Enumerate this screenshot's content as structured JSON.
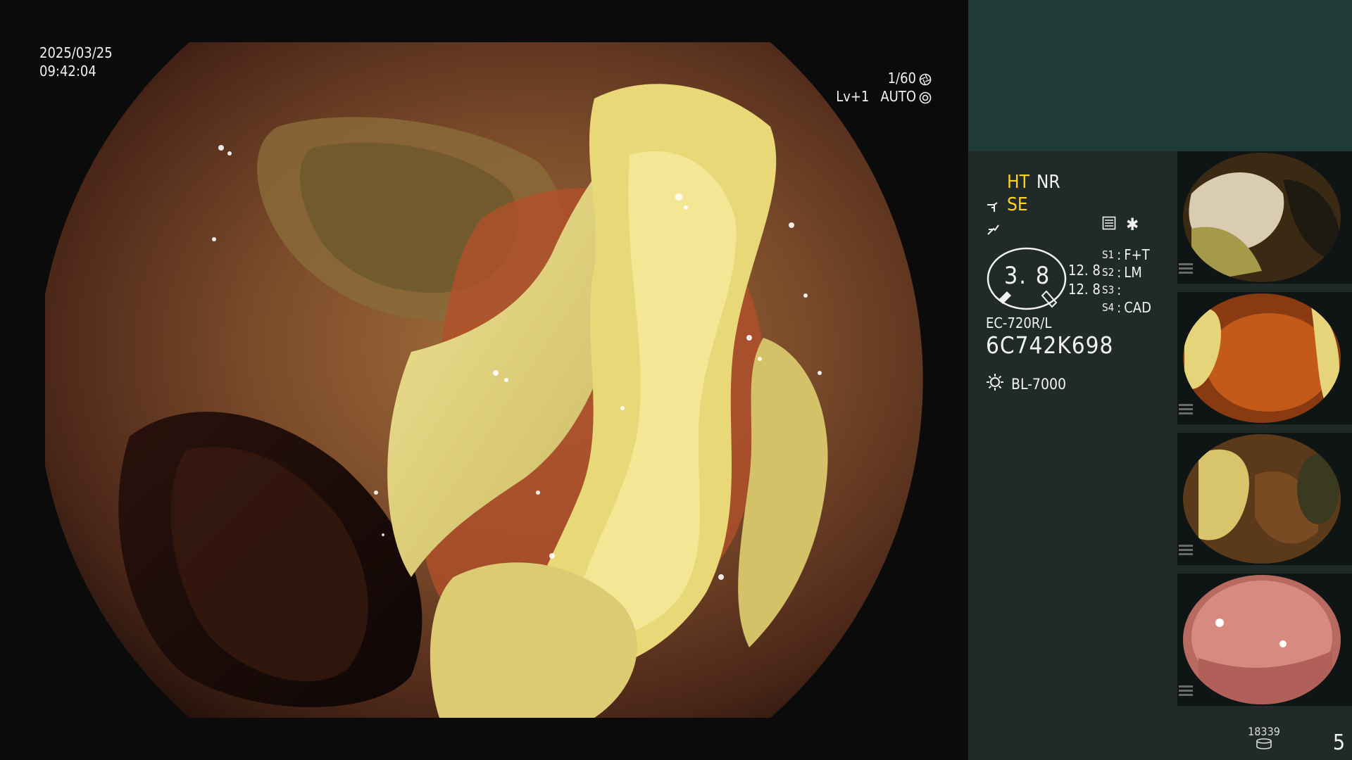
{
  "main": {
    "date": "2025/03/25",
    "time": "09:42:04",
    "shutter": "1/60",
    "level": "Lv+1",
    "exposure_mode": "AUTO"
  },
  "panel": {
    "mode_ht": "HT",
    "mode_nr": "NR",
    "mode_se": "SE",
    "gauge_value": "3. 8",
    "gauge_sub_1": "12. 8",
    "gauge_sub_2": "12. 8",
    "settings": [
      {
        "key": "S1",
        "value": "F+T"
      },
      {
        "key": "S2",
        "value": "LM"
      },
      {
        "key": "S3",
        "value": ""
      },
      {
        "key": "S4",
        "value": "CAD"
      }
    ],
    "scope_model": "EC-720R/L",
    "scope_serial": "6C742K698",
    "light_source": "BL-7000",
    "counter": "18339",
    "page": "5"
  },
  "colors": {
    "accent_yellow": "#ffd21e",
    "panel_top": "#1e3b38",
    "panel_bg": "#1f2a29"
  },
  "icons": {
    "shutter": "aperture-icon",
    "exposure": "exposure-icon",
    "scope": "scope-icon",
    "zoom": "zoom-icon",
    "settings_menu": "menu-icon",
    "star": "star-icon",
    "light": "light-icon",
    "storage": "storage-icon"
  }
}
